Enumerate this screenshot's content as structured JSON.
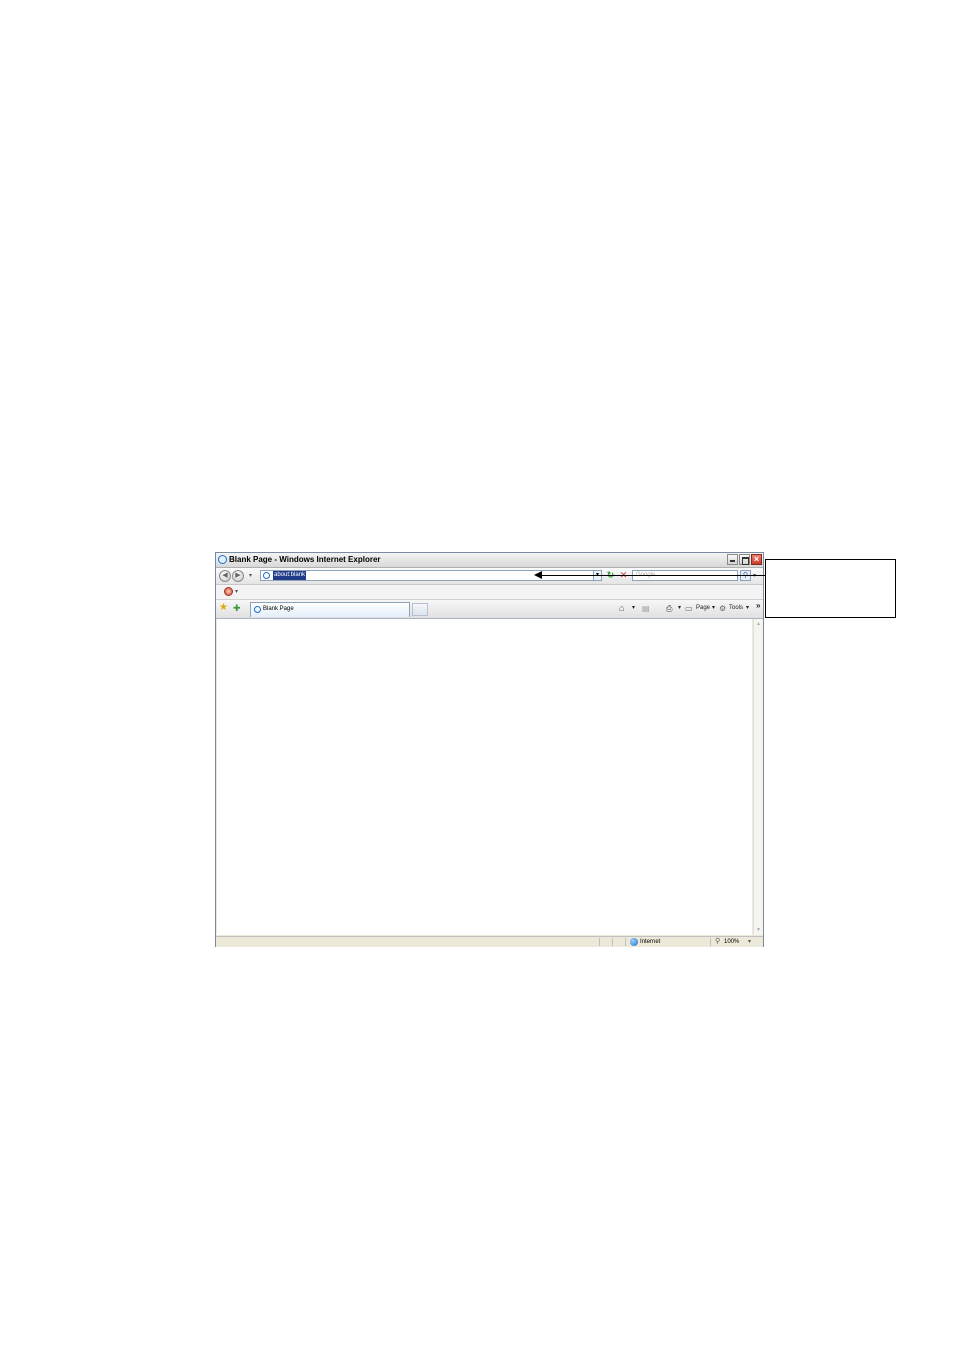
{
  "window": {
    "title": "Blank Page - Windows Internet Explorer",
    "close_glyph": "×"
  },
  "navbar": {
    "back_glyph": "◀",
    "forward_glyph": "▶",
    "recent_pages_glyph": "▾",
    "address_value": "about:blank",
    "address_dropdown_glyph": "▾",
    "refresh_glyph": "↻",
    "stop_glyph": "✕",
    "search_placeholder": "Google",
    "search_button_glyph": "⚲",
    "search_dropdown_glyph": "▾"
  },
  "linkbar": {
    "addon_dropdown_glyph": "▾"
  },
  "tabbar": {
    "favorites_glyph": "★",
    "add_favorite_glyph": "✚",
    "active_tab_label": "Blank Page",
    "commands": {
      "home_glyph": "⌂",
      "home_dropdown": "▾",
      "feeds_glyph": "▤",
      "print_glyph": "⎙",
      "print_dropdown": "▾",
      "page_glyph": "▭",
      "page_label": "Page",
      "page_dropdown": "▾",
      "tools_glyph": "⚙",
      "tools_label": "Tools",
      "tools_dropdown": "▾",
      "more_glyph": "»"
    }
  },
  "scrollbar": {
    "up_glyph": "▲",
    "down_glyph": "▼"
  },
  "statusbar": {
    "zone_label": "Internet",
    "zoom_glyph": "⚲",
    "zoom_level": "100%",
    "zoom_dropdown": "▾"
  },
  "icons": {
    "ie_logo": "ie-logo-icon",
    "favorites": "star-icon",
    "add_favorite": "add-favorite-icon",
    "home": "home-icon",
    "feeds": "rss-feed-icon",
    "print": "printer-icon",
    "page": "page-icon",
    "tools": "gear-icon",
    "zone": "globe-icon",
    "zoom": "magnifier-icon",
    "addon": "addon-icon"
  }
}
